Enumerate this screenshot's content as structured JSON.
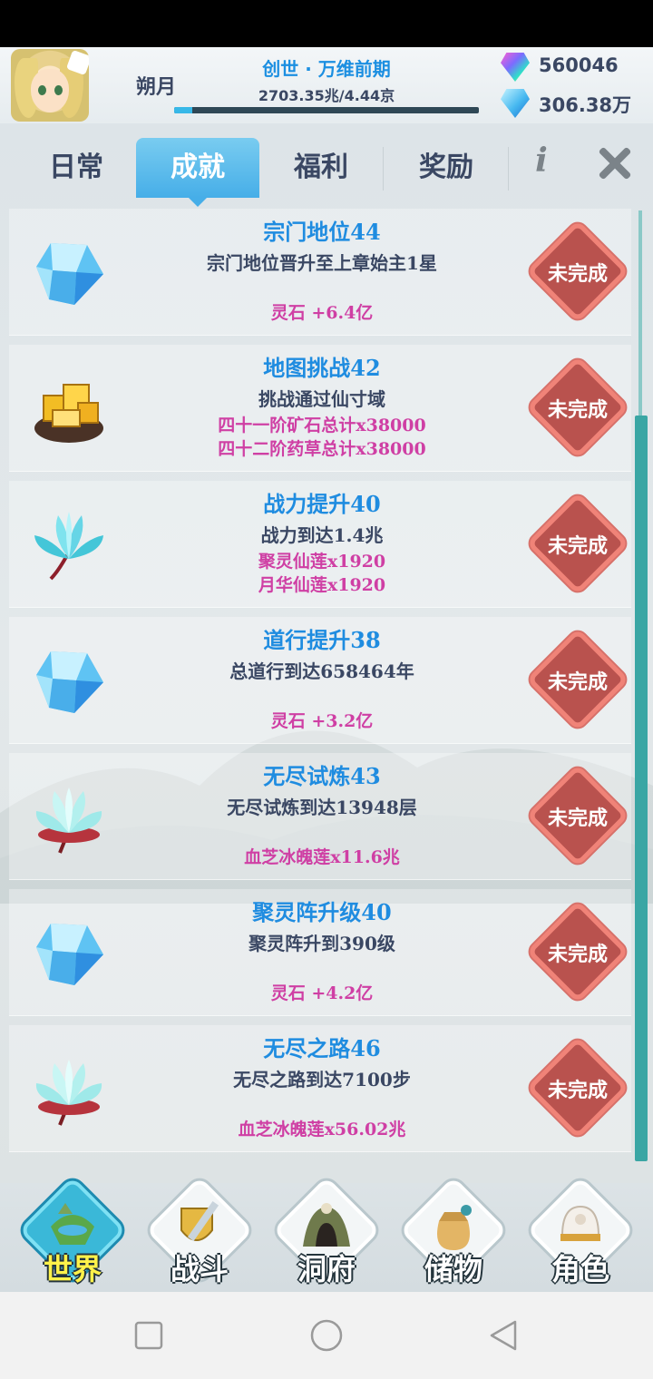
{
  "header": {
    "player_name": "朔月",
    "realm": "创世 · 万维前期",
    "exp_text": "2703.35兆/4.44京",
    "exp_fraction": 0.06,
    "currency": [
      {
        "icon": "rainbow-gem-icon",
        "value": "560046"
      },
      {
        "icon": "blue-gem-icon",
        "value": "306.38万"
      }
    ]
  },
  "tabs": [
    {
      "label": "日常",
      "active": false
    },
    {
      "label": "成就",
      "active": true
    },
    {
      "label": "福利",
      "active": false
    },
    {
      "label": "奖励",
      "active": false
    }
  ],
  "info_label": "i",
  "achievements": [
    {
      "icon": "blue-gem-icon",
      "title": "宗门地位44",
      "desc": "宗门地位晋升至上章始主1星",
      "rewards": [
        "灵石 +6.4亿"
      ],
      "status": "未完成"
    },
    {
      "icon": "gold-ore-icon",
      "title": "地图挑战42",
      "desc": "挑战通过仙寸域",
      "rewards": [
        "四十一阶矿石总计x38000",
        "四十二阶药草总计x38000"
      ],
      "status": "未完成"
    },
    {
      "icon": "blue-lotus-icon",
      "title": "战力提升40",
      "desc": "战力到达1.4兆",
      "rewards": [
        "聚灵仙莲x1920",
        "月华仙莲x1920"
      ],
      "status": "未完成"
    },
    {
      "icon": "blue-gem-icon",
      "title": "道行提升38",
      "desc": "总道行到达658464年",
      "rewards": [
        "灵石 +3.2亿"
      ],
      "status": "未完成"
    },
    {
      "icon": "ice-lotus-icon",
      "title": "无尽试炼43",
      "desc": "无尽试炼到达13948层",
      "rewards": [
        "血芝冰魄莲x11.6兆"
      ],
      "status": "未完成"
    },
    {
      "icon": "blue-gem-icon",
      "title": "聚灵阵升级40",
      "desc": "聚灵阵升到390级",
      "rewards": [
        "灵石 +4.2亿"
      ],
      "status": "未完成"
    },
    {
      "icon": "ice-lotus-icon",
      "title": "无尽之路46",
      "desc": "无尽之路到达7100步",
      "rewards": [
        "血芝冰魄莲x56.02兆"
      ],
      "status": "未完成"
    }
  ],
  "bottom_nav": [
    {
      "label": "世界",
      "icon": "floating-island-icon",
      "active": true
    },
    {
      "label": "战斗",
      "icon": "sword-shield-icon",
      "active": false
    },
    {
      "label": "洞府",
      "icon": "cave-icon",
      "active": false
    },
    {
      "label": "储物",
      "icon": "storage-bag-icon",
      "active": false
    },
    {
      "label": "角色",
      "icon": "character-hat-icon",
      "active": false
    }
  ],
  "colors": {
    "accent_blue": "#1f8ce0",
    "reward_pink": "#cf3fa4",
    "status_red": "#b9524e",
    "scrollbar": "#3aa6a4"
  }
}
